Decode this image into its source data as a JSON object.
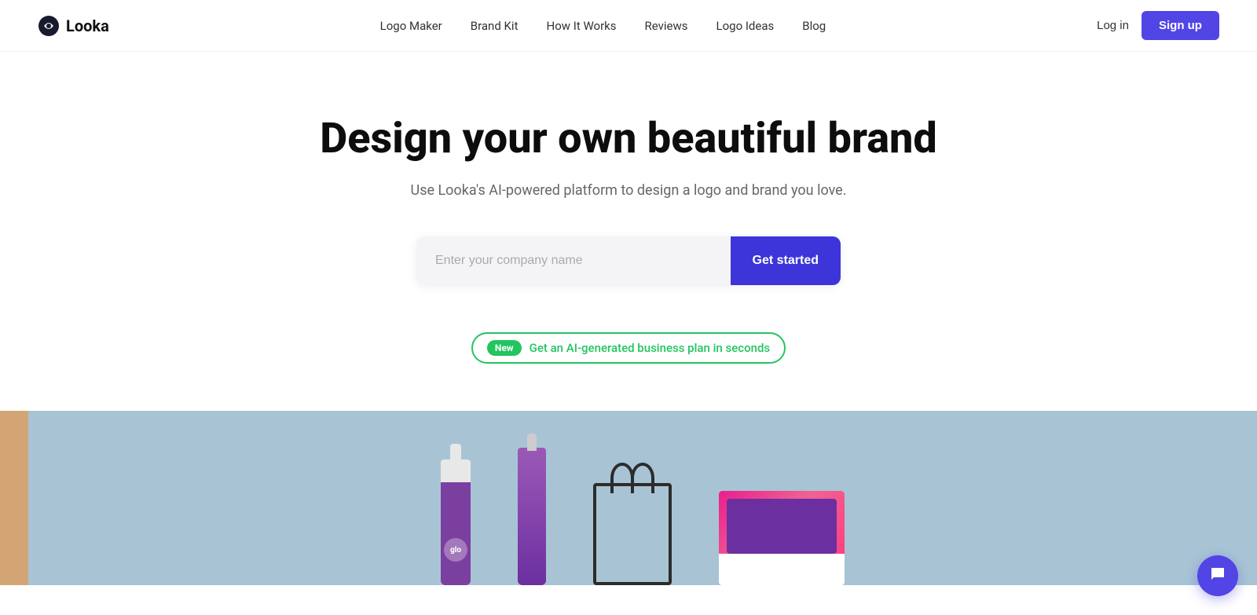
{
  "brand": {
    "logo_text": "Looka",
    "logo_icon": "◑"
  },
  "nav": {
    "links": [
      {
        "label": "Logo Maker",
        "id": "logo-maker"
      },
      {
        "label": "Brand Kit",
        "id": "brand-kit"
      },
      {
        "label": "How It Works",
        "id": "how-it-works"
      },
      {
        "label": "Reviews",
        "id": "reviews"
      },
      {
        "label": "Logo Ideas",
        "id": "logo-ideas"
      },
      {
        "label": "Blog",
        "id": "blog"
      }
    ],
    "login_label": "Log in",
    "signup_label": "Sign up"
  },
  "hero": {
    "title": "Design your own beautiful brand",
    "subtitle": "Use Looka's AI-powered platform to design a logo and brand you love.",
    "input_placeholder": "Enter your company name",
    "cta_label": "Get started"
  },
  "promo_badge": {
    "new_label": "New",
    "text": "Get an AI-generated business plan in seconds"
  },
  "chat_widget": {
    "icon": "💬"
  }
}
